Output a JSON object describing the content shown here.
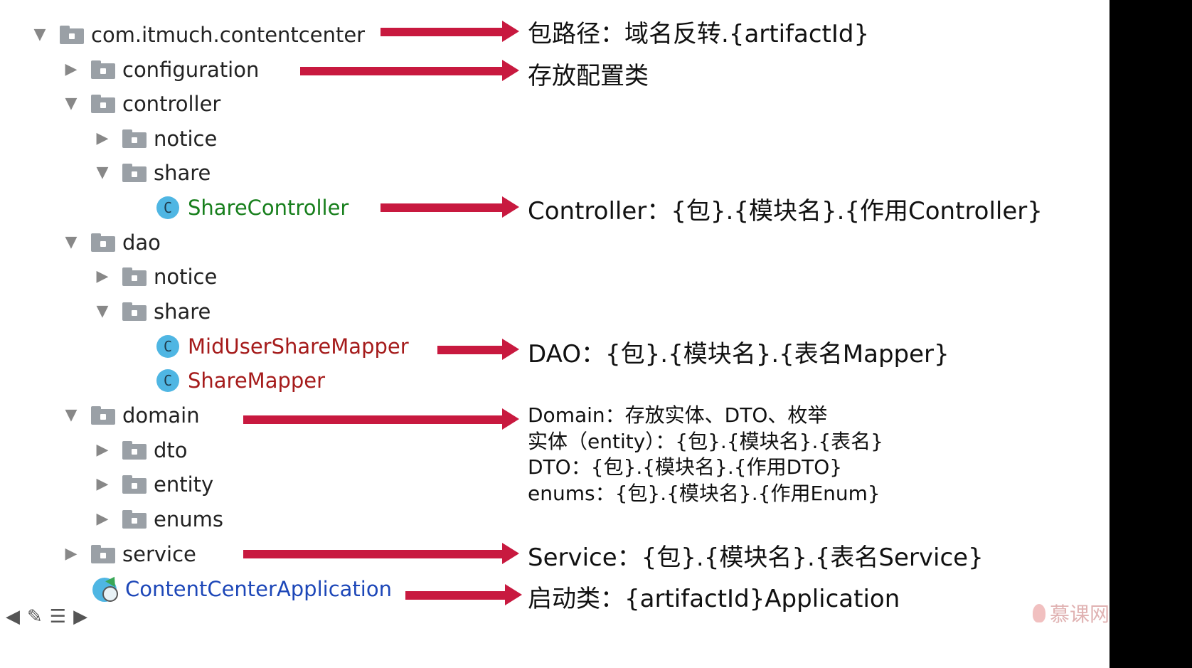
{
  "tree": {
    "root": "com.itmuch.contentcenter",
    "configuration": "configuration",
    "controller": "controller",
    "controller_notice": "notice",
    "controller_share": "share",
    "share_controller": "ShareController",
    "dao": "dao",
    "dao_notice": "notice",
    "dao_share": "share",
    "mid_user_share_mapper": "MidUserShareMapper",
    "share_mapper": "ShareMapper",
    "domain": "domain",
    "dto": "dto",
    "entity": "entity",
    "enums": "enums",
    "service": "service",
    "app": "ContentCenterApplication"
  },
  "annotations": {
    "root": "包路径：域名反转.{artifactId}",
    "configuration": "存放配置类",
    "controller": "Controller：{包}.{模块名}.{作用Controller}",
    "dao": "DAO：{包}.{模块名}.{表名Mapper}",
    "domain_1": "Domain：存放实体、DTO、枚举",
    "domain_2": "实体（entity）：{包}.{模块名}.{表名}",
    "domain_3": "DTO：{包}.{模块名}.{作用DTO}",
    "domain_4": "enums：{包}.{模块名}.{作用Enum}",
    "service": "Service：{包}.{模块名}.{表名Service}",
    "app": "启动类：{artifactId}Application"
  },
  "icons": {
    "expanded": "▼",
    "collapsed": "▶",
    "class_letter": "C"
  },
  "watermark": "慕课网",
  "colors": {
    "arrow": "#c8193f",
    "controller_class": "#177f1c",
    "mapper_class": "#a51b1b",
    "application_class": "#1d47b8"
  }
}
